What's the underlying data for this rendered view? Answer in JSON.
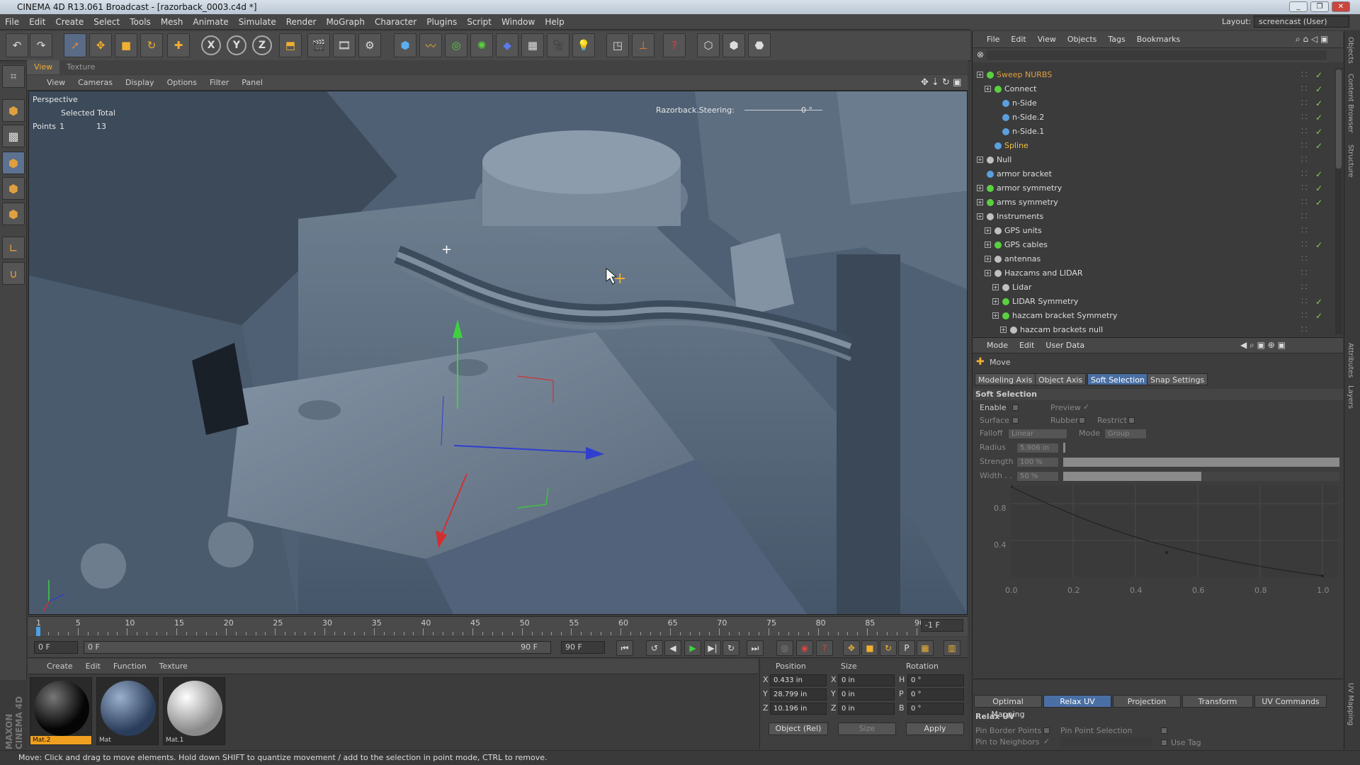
{
  "window": {
    "title": "CINEMA 4D R13.061 Broadcast - [razorback_0003.c4d *]"
  },
  "menubar": [
    "File",
    "Edit",
    "Create",
    "Select",
    "Tools",
    "Mesh",
    "Animate",
    "Simulate",
    "Render",
    "MoGraph",
    "Character",
    "Plugins",
    "Script",
    "Window",
    "Help"
  ],
  "layout": {
    "label": "Layout:",
    "value": "screencast (User)"
  },
  "viewport": {
    "tabs": [
      "View",
      "Texture"
    ],
    "menu": [
      "View",
      "Cameras",
      "Display",
      "Options",
      "Filter",
      "Panel"
    ],
    "camera": "Perspective",
    "selected_total_label": "Selected Total",
    "points_label": "Points",
    "points_selected": "1",
    "points_total": "13",
    "steering_label": "Razorback.Steering:",
    "steering_value": "0 °"
  },
  "timeline": {
    "ticks": [
      "1",
      "5",
      "10",
      "15",
      "20",
      "25",
      "30",
      "35",
      "40",
      "45",
      "50",
      "55",
      "60",
      "65",
      "70",
      "75",
      "80",
      "85",
      "90"
    ],
    "current": "-1 F",
    "start": "0 F",
    "range_start": "0 F",
    "range_end": "90 F",
    "end": "90 F"
  },
  "materials": {
    "menu": [
      "Create",
      "Edit",
      "Function",
      "Texture"
    ],
    "items": [
      {
        "label": "Mat.2"
      },
      {
        "label": "Mat"
      },
      {
        "label": "Mat.1"
      }
    ]
  },
  "coords": {
    "headers": [
      "Position",
      "Size",
      "Rotation"
    ],
    "rows": [
      {
        "axis": "X",
        "pos": "0.433 in",
        "sax": "X",
        "size": "0 in",
        "rax": "H",
        "rot": "0 °"
      },
      {
        "axis": "Y",
        "pos": "28.799 in",
        "sax": "Y",
        "size": "0 in",
        "rax": "P",
        "rot": "0 °"
      },
      {
        "axis": "Z",
        "pos": "10.196 in",
        "sax": "Z",
        "size": "0 in",
        "rax": "B",
        "rot": "0 °"
      }
    ],
    "mode": "Object (Rel)",
    "size_mode": "Size",
    "apply": "Apply"
  },
  "objects": {
    "menu": [
      "File",
      "Edit",
      "View",
      "Objects",
      "Tags",
      "Bookmarks"
    ],
    "rows": [
      {
        "name": "Sweep NURBS",
        "color": "#e0a040",
        "icon": "#5ad040"
      },
      {
        "name": "Connect",
        "color": "#dddddd",
        "icon": "#5ad040"
      },
      {
        "name": "n-Side",
        "color": "#dddddd",
        "icon": "#5aa0e0"
      },
      {
        "name": "n-Side.2",
        "color": "#dddddd",
        "icon": "#5aa0e0"
      },
      {
        "name": "n-Side.1",
        "color": "#dddddd",
        "icon": "#5aa0e0"
      },
      {
        "name": "Spline",
        "color": "#f0c040",
        "icon": "#5aa0e0"
      },
      {
        "name": "Null",
        "color": "#dddddd",
        "icon": "#c0c0c0"
      },
      {
        "name": "armor bracket",
        "color": "#dddddd",
        "icon": "#5aa0e0"
      },
      {
        "name": "armor symmetry",
        "color": "#dddddd",
        "icon": "#5ad040"
      },
      {
        "name": "arms symmetry",
        "color": "#dddddd",
        "icon": "#5ad040"
      },
      {
        "name": "Instruments",
        "color": "#dddddd",
        "icon": "#c0c0c0"
      },
      {
        "name": "GPS units",
        "color": "#dddddd",
        "icon": "#c0c0c0"
      },
      {
        "name": "GPS cables",
        "color": "#dddddd",
        "icon": "#5ad040"
      },
      {
        "name": "antennas",
        "color": "#dddddd",
        "icon": "#c0c0c0"
      },
      {
        "name": "Hazcams and LIDAR",
        "color": "#dddddd",
        "icon": "#c0c0c0"
      },
      {
        "name": "Lidar",
        "color": "#dddddd",
        "icon": "#c0c0c0"
      },
      {
        "name": "LIDAR Symmetry",
        "color": "#dddddd",
        "icon": "#5ad040"
      },
      {
        "name": "hazcam bracket Symmetry",
        "color": "#dddddd",
        "icon": "#5ad040"
      },
      {
        "name": "hazcam brackets null",
        "color": "#dddddd",
        "icon": "#c0c0c0"
      }
    ]
  },
  "attributes": {
    "menu": [
      "Mode",
      "Edit",
      "User Data"
    ],
    "tool": "Move",
    "tabs": [
      "Modeling Axis",
      "Object Axis",
      "Soft Selection",
      "Snap Settings"
    ],
    "section": "Soft Selection",
    "enable": "Enable",
    "preview": "Preview",
    "surface": "Surface",
    "rubber": "Rubber",
    "restrict": "Restrict",
    "falloff": "Falloff",
    "falloff_value": "Linear",
    "mode": "Mode",
    "mode_value": "Group",
    "radius": "Radius",
    "radius_value": "5.906 in",
    "strength": "Strength",
    "strength_value": "100 %",
    "strength_fill": 1.0,
    "width": "Width . .",
    "width_value": "50 %",
    "width_fill": 0.5,
    "graph_y": [
      "0.8",
      "0.4"
    ],
    "graph_x": [
      "0.0",
      "0.2",
      "0.4",
      "0.6",
      "0.8",
      "1.0"
    ]
  },
  "uv": {
    "tabs": [
      "Optimal Mapping",
      "Relax UV",
      "Projection",
      "Transform",
      "UV Commands"
    ],
    "section": "Relax UV",
    "pin_border": "Pin Border Points",
    "pin_point": "Pin Point Selection",
    "pin_neighbors": "Pin to Neighbors",
    "use_tag": "Use Tag"
  },
  "side_tabs": [
    "Objects",
    "Content Browser",
    "Structure",
    "Attributes",
    "Layers",
    "UV Mapping"
  ],
  "status": "Move: Click and drag to move elements. Hold down SHIFT to quantize movement / add to the selection in point mode, CTRL to remove.",
  "brand": "MAXON CINEMA 4D"
}
